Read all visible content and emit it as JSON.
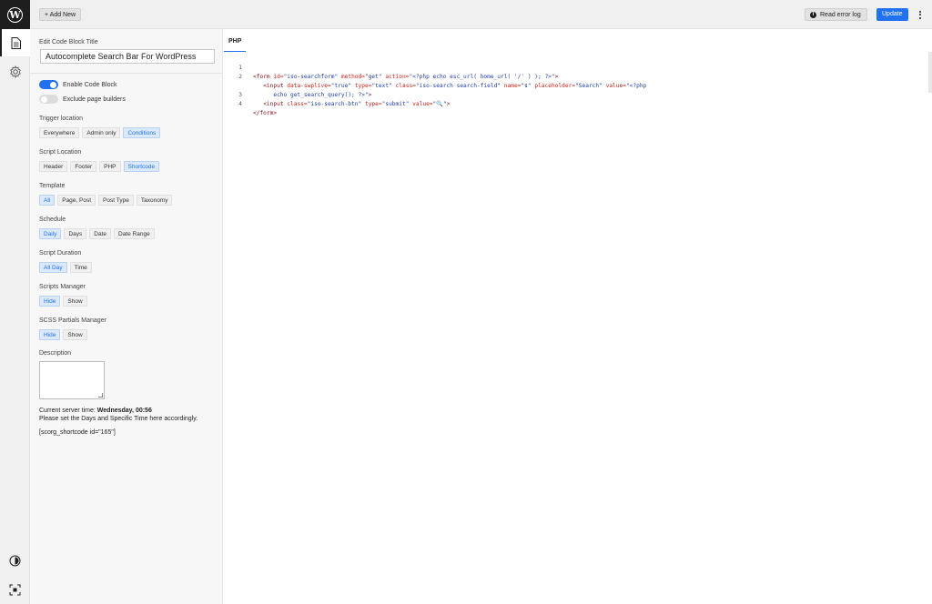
{
  "topbar": {
    "add_new": "+ Add New",
    "read_error_log": "Read error log",
    "update": "Update"
  },
  "panel": {
    "title_label": "Edit Code Block Title",
    "title_value": "Autocomplete Search Bar For WordPress",
    "enable_code_block": "Enable Code Block",
    "exclude_page_builders": "Exclude page builders",
    "enable_code_block_on": true,
    "exclude_page_builders_on": false,
    "groups": [
      {
        "label": "Trigger location",
        "options": [
          "Everywhere",
          "Admin only",
          "Conditions"
        ],
        "selected": "Conditions"
      },
      {
        "label": "Script Location",
        "options": [
          "Header",
          "Footer",
          "PHP",
          "Shortcode"
        ],
        "selected": "Shortcode"
      },
      {
        "label": "Template",
        "options": [
          "All",
          "Page, Post",
          "Post Type",
          "Taxonomy"
        ],
        "selected": "All"
      },
      {
        "label": "Schedule",
        "options": [
          "Daily",
          "Days",
          "Date",
          "Date Range"
        ],
        "selected": "Daily"
      },
      {
        "label": "Script Duration",
        "options": [
          "All Day",
          "Time"
        ],
        "selected": "All Day"
      },
      {
        "label": "Scripts Manager",
        "options": [
          "Hide",
          "Show"
        ],
        "selected": "Hide"
      },
      {
        "label": "SCSS Partials Manager",
        "options": [
          "Hide",
          "Show"
        ],
        "selected": "Hide"
      }
    ],
    "description_label": "Description",
    "server_time_label": "Current server time: ",
    "server_time_value": "Wednesday, 00:56",
    "hint": "Please set the Days and Specific Time here accordingly.",
    "shortcode": "[scorg_shortcode id=\"165\"]"
  },
  "editor": {
    "tab": "PHP",
    "line_numbers": [
      "1",
      "2",
      "",
      "3",
      "4"
    ]
  },
  "icons": {
    "logo": "wordpress-logo",
    "rail_1": "document-icon",
    "rail_2": "gear-icon",
    "rail_bottom_1": "contrast-icon",
    "rail_bottom_2": "focus-icon"
  }
}
